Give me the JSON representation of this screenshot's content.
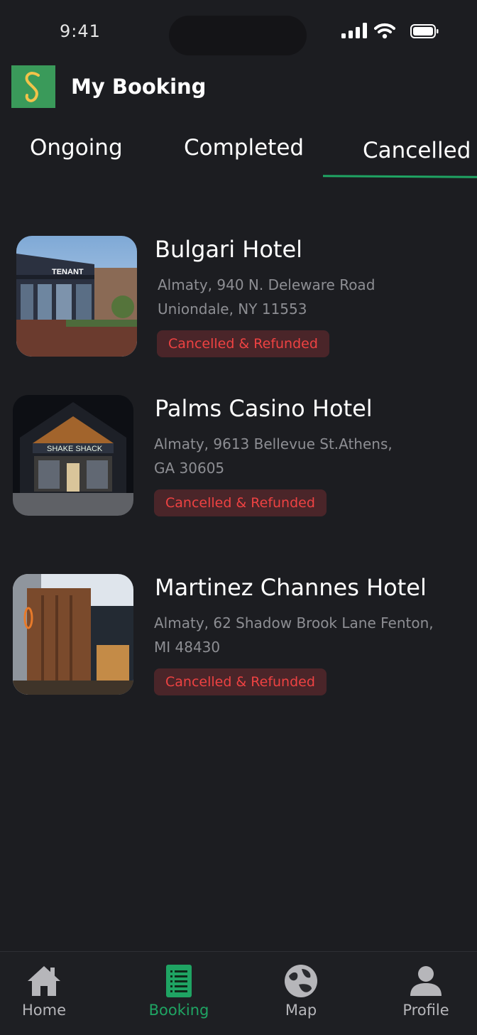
{
  "status_bar": {
    "time": "9:41"
  },
  "header": {
    "title": "My Booking",
    "logo_letter": "S"
  },
  "tabs": [
    {
      "label": "Ongoing"
    },
    {
      "label": "Completed"
    },
    {
      "label": "Cancelled",
      "active": true
    }
  ],
  "bookings": [
    {
      "name": "Bulgari Hotel",
      "address_line1": "Almaty, 940 N. Deleware Road",
      "address_line2": "Uniondale, NY 11553",
      "status": "Cancelled & Refunded",
      "sign_text": "TENANT"
    },
    {
      "name": "Palms Casino Hotel",
      "address_line1": "Almaty, 9613 Bellevue St.Athens,",
      "address_line2": "GA 30605",
      "status": "Cancelled & Refunded",
      "sign_text": "SHAKE SHACK"
    },
    {
      "name": "Martinez Channes Hotel",
      "address_line1": "Almaty, 62 Shadow Brook Lane Fenton,",
      "address_line2": "MI 48430",
      "status": "Cancelled & Refunded"
    }
  ],
  "nav": [
    {
      "label": "Home",
      "icon": "home-icon"
    },
    {
      "label": "Booking",
      "icon": "booking-icon",
      "active": true
    },
    {
      "label": "Map",
      "icon": "globe-icon"
    },
    {
      "label": "Profile",
      "icon": "user-icon"
    }
  ],
  "colors": {
    "accent": "#1fa463",
    "background": "#1c1d21",
    "badge_bg": "#4a2529",
    "badge_text": "#ee4242"
  }
}
